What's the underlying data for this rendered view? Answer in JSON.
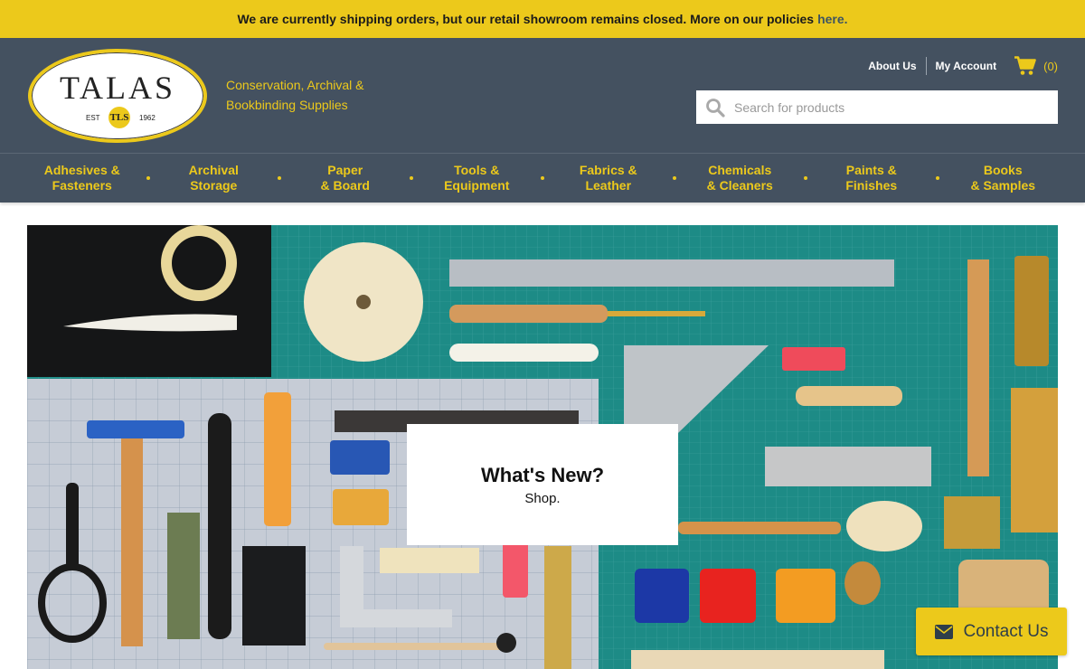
{
  "announcement": {
    "text": "We are currently shipping orders, but our retail showroom remains closed. More on our policies",
    "link": "here."
  },
  "logo": {
    "word": "TALAS",
    "est": "EST",
    "year": "1962",
    "seal": "TLS"
  },
  "tagline": "Conservation, Archival &\nBookbinding Supplies",
  "util": {
    "about": "About Us",
    "account": "My Account",
    "cart_count": "(0)"
  },
  "search": {
    "placeholder": "Search for products"
  },
  "nav": [
    {
      "label": "Adhesives &\nFasteners"
    },
    {
      "label": "Archival\nStorage"
    },
    {
      "label": "Paper\n& Board"
    },
    {
      "label": "Tools &\nEquipment"
    },
    {
      "label": "Fabrics &\nLeather"
    },
    {
      "label": "Chemicals\n& Cleaners"
    },
    {
      "label": "Paints &\nFinishes"
    },
    {
      "label": "Books\n& Samples"
    }
  ],
  "hero": {
    "title": "What's New?",
    "subtitle": "Shop."
  },
  "contact": {
    "label": "Contact Us"
  },
  "colors": {
    "brand_yellow": "#ecc91b",
    "header_slate": "#445160",
    "mat_teal": "#1d8b86"
  },
  "icons": [
    "search-icon",
    "cart-icon",
    "envelope-icon"
  ]
}
